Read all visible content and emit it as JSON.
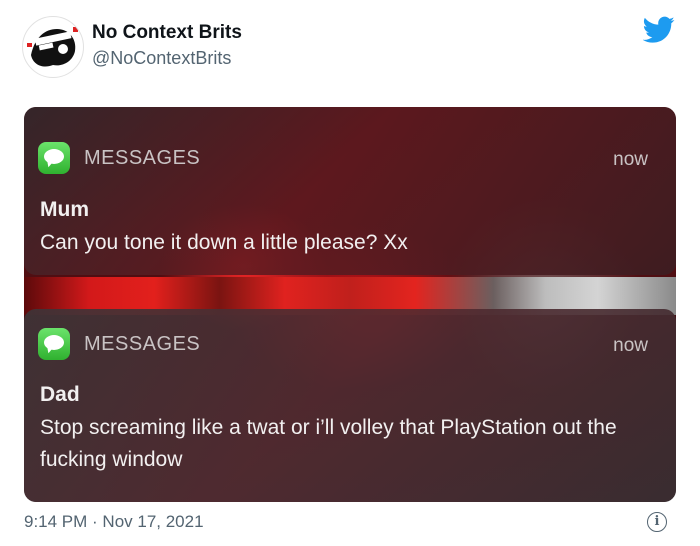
{
  "author": {
    "display_name": "No Context Brits",
    "handle": "@NoContextBrits",
    "avatar_icon": "avatar-icon",
    "brand_icon": "twitter-bird-icon",
    "brand_color": "#1d9bf0"
  },
  "notifications": [
    {
      "app_icon": "messages-icon",
      "app_name": "MESSAGES",
      "time": "now",
      "sender": "Mum",
      "body": "Can you tone it down a little please? Xx"
    },
    {
      "app_icon": "messages-icon",
      "app_name": "MESSAGES",
      "time": "now",
      "sender": "Dad",
      "body": "Stop screaming like a twat or i’ll volley that PlayStation out the fucking window"
    }
  ],
  "footer": {
    "timestamp": "9:14 PM · Nov 17, 2021",
    "info_icon": "info-icon"
  }
}
